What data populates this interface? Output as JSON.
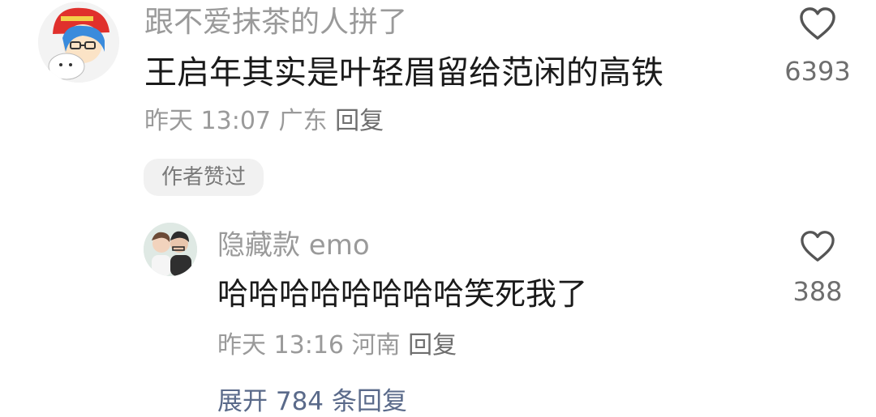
{
  "comments": [
    {
      "username": "跟不爱抹茶的人拼了",
      "text": "王启年其实是叶轻眉留给范闲的高铁",
      "meta_time": "昨天 13:07",
      "meta_location": "广东",
      "meta_reply": "回复",
      "likes": "6393",
      "badge": "作者赞过"
    },
    {
      "username": "隐藏款 emo",
      "text": "哈哈哈哈哈哈哈哈笑死我了",
      "meta_time": "昨天 13:16",
      "meta_location": "河南",
      "meta_reply": "回复",
      "likes": "388"
    }
  ],
  "expand_replies": "展开 784 条回复",
  "icons": {
    "like": "heart-outline-icon",
    "avatar1": "avatar",
    "avatar2": "avatar"
  },
  "colors": {
    "username": "#9a9a9a",
    "text": "#1a1a1a",
    "meta": "#9a9a9a",
    "badge_bg": "#f1f1f1"
  }
}
